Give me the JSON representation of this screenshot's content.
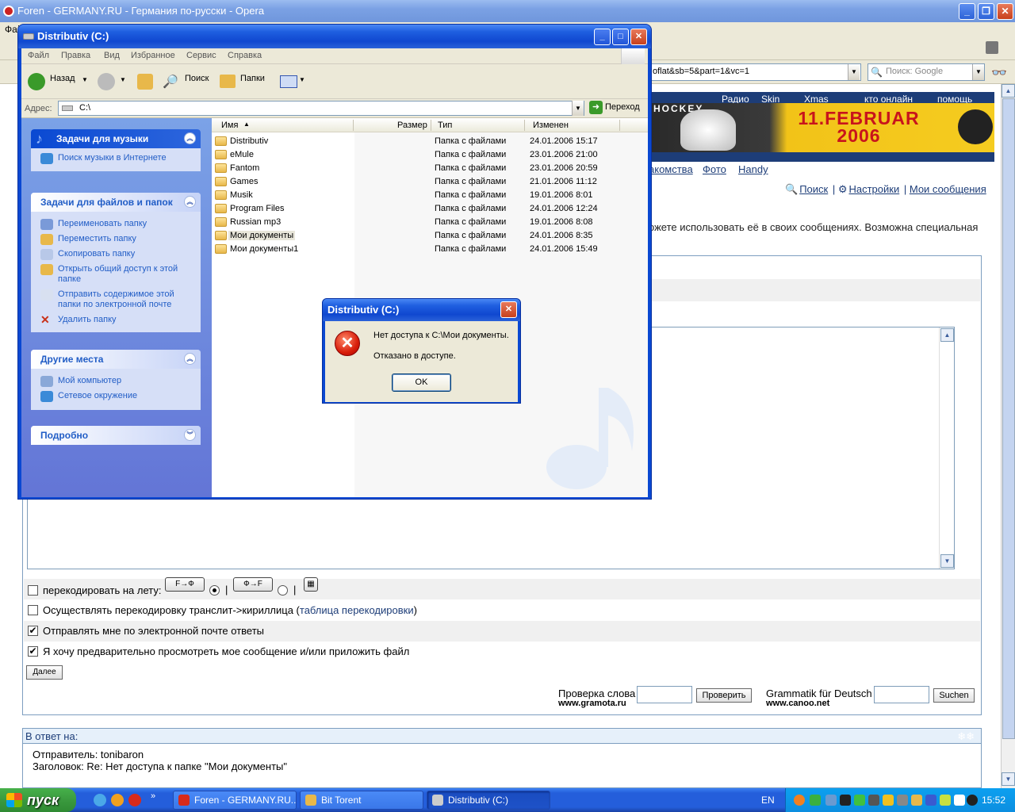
{
  "opera": {
    "title": "Foren - GERMANY.RU - Германия по-русски - Opera",
    "menu_first": "Фай",
    "url": "oflat&sb=5&part=1&vc=1",
    "search_placeholder": "Поиск: Google"
  },
  "site": {
    "top_links": [
      "Радио",
      "Skin",
      "Xmas",
      "кто онлайн",
      "помощь"
    ],
    "banner": {
      "hockey": "HOCKEY",
      "date_line1": "11.FEBRUAR",
      "date_line2": "2006"
    },
    "nav_links": [
      "акомства",
      "Фото",
      "Handy"
    ],
    "user_links": [
      "Поиск",
      "Настройки",
      "Мои сообщения"
    ],
    "truncated_text": "ожете использовать её в своих сообщениях. Возможна специальная"
  },
  "form": {
    "recode_label": "перекодировать на лету:",
    "btn_ftof": "F→Ф",
    "btn_ftof2": "Ф→F",
    "translit_label": "Осуществлять перекодировку транслит->кириллица (",
    "translit_link": "таблица перекодировки",
    "translit_end": ")",
    "email_label": "Отправлять мне по электронной почте ответы",
    "preview_label": "Я хочу предварительно просмотреть мое сообщение и/или приложить файл",
    "next_button": "Далее",
    "check_word_label": "Проверка слова",
    "gramota_site": "www.gramota.ru",
    "check_button": "Проверить",
    "grammatik_label": "Grammatik für Deutsch",
    "canoo_site": "www.canoo.net",
    "search_button": "Suchen"
  },
  "reply": {
    "header": "В ответ на:",
    "sender": "Отправитель: tonibaron",
    "subject": "Заголовок: Re: Нет доступа к папке \"Мои документы\""
  },
  "explorer": {
    "title": "Distributiv (C:)",
    "menu": [
      "Файл",
      "Правка",
      "Вид",
      "Избранное",
      "Сервис",
      "Справка"
    ],
    "toolbar": {
      "back": "Назад",
      "search": "Поиск",
      "folders": "Папки"
    },
    "address_label": "Адрес:",
    "address_value": "C:\\",
    "go_label": "Переход",
    "panels": {
      "music": {
        "title": "Задачи для музыки",
        "items": [
          "Поиск музыки в Интернете"
        ]
      },
      "files": {
        "title": "Задачи для файлов и папок",
        "items": [
          "Переименовать папку",
          "Переместить папку",
          "Скопировать папку",
          "Открыть общий доступ к этой папке",
          "Отправить содержимое этой папки по электронной почте",
          "Удалить папку"
        ]
      },
      "places": {
        "title": "Другие места",
        "items": [
          "Мой компьютер",
          "Сетевое окружение"
        ]
      },
      "details": {
        "title": "Подробно"
      }
    },
    "columns": [
      "Имя",
      "Размер",
      "Тип",
      "Изменен"
    ],
    "files": [
      {
        "name": "Distributiv",
        "type": "Папка с файлами",
        "date": "24.01.2006 15:17"
      },
      {
        "name": "eMule",
        "type": "Папка с файлами",
        "date": "23.01.2006 21:00"
      },
      {
        "name": "Fantom",
        "type": "Папка с файлами",
        "date": "23.01.2006 20:59"
      },
      {
        "name": "Games",
        "type": "Папка с файлами",
        "date": "21.01.2006 11:12"
      },
      {
        "name": "Musik",
        "type": "Папка с файлами",
        "date": "19.01.2006 8:01"
      },
      {
        "name": "Program Files",
        "type": "Папка с файлами",
        "date": "24.01.2006 12:24"
      },
      {
        "name": "Russian mp3",
        "type": "Папка с файлами",
        "date": "19.01.2006 8:08"
      },
      {
        "name": "Мои документы",
        "type": "Папка с файлами",
        "date": "24.01.2006 8:35"
      },
      {
        "name": "Мои документы1",
        "type": "Папка с файлами",
        "date": "24.01.2006 15:49"
      }
    ]
  },
  "dialog": {
    "title": "Distributiv (C:)",
    "message1": "Нет доступа к C:\\Мои документы.",
    "message2": "Отказано в доступе.",
    "ok": "OK"
  },
  "taskbar": {
    "start": "пуск",
    "tasks": [
      "Foren - GERMANY.RU...",
      "Bit Torent",
      "Distributiv (C:)"
    ],
    "lang": "EN",
    "clock": "15:52"
  }
}
